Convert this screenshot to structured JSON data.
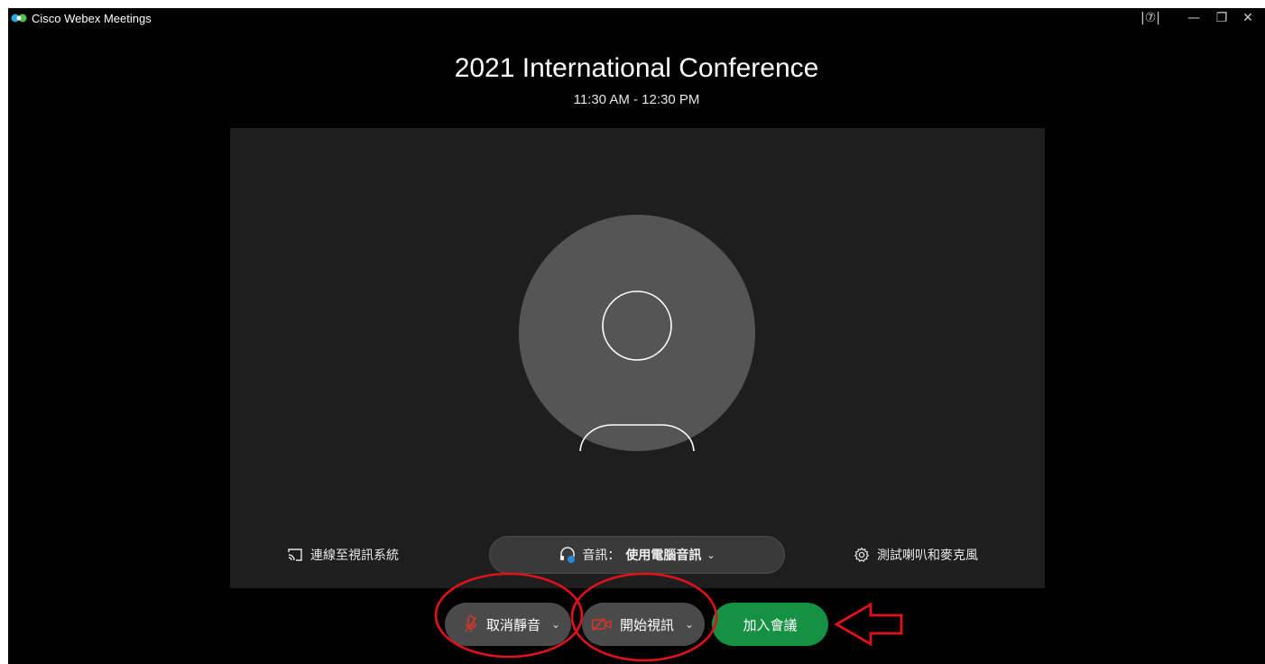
{
  "window": {
    "app_name": "Cisco Webex Meetings",
    "help_icon_text": "|⑦|",
    "minimize_glyph": "—",
    "restore_glyph": "❐",
    "close_glyph": "✕"
  },
  "meeting": {
    "title": "2021 International Conference",
    "time": "11:30 AM - 12:30 PM"
  },
  "preview": {
    "connect_video_label": "連線至視訊系統",
    "audio_label": "音訊：",
    "audio_value": "使用電腦音訊",
    "test_label": "測試喇叭和麥克風"
  },
  "controls": {
    "mute_label": "取消靜音",
    "video_label": "開始視訊",
    "join_label": "加入會議"
  },
  "colors": {
    "background": "#000000",
    "panel": "#1e1e1e",
    "avatar": "#555555",
    "join_green": "#159143",
    "annotation_red": "#e0121c",
    "muted_icon_red": "#e0352b"
  }
}
